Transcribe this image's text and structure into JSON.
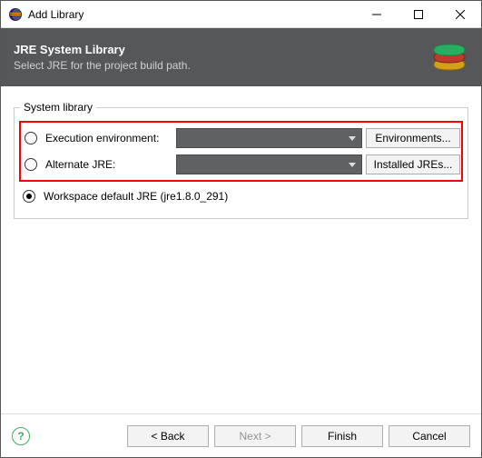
{
  "titlebar": {
    "title": "Add Library"
  },
  "header": {
    "title": "JRE System Library",
    "subtitle": "Select JRE for the project build path."
  },
  "fieldset": {
    "legend": "System library"
  },
  "options": {
    "exec_env": {
      "label": "Execution environment:",
      "button": "Environments..."
    },
    "alt_jre": {
      "label": "Alternate JRE:",
      "button": "Installed JREs..."
    },
    "workspace": {
      "label": "Workspace default JRE (jre1.8.0_291)"
    }
  },
  "footer": {
    "back": "< Back",
    "next": "Next >",
    "finish": "Finish",
    "cancel": "Cancel"
  }
}
